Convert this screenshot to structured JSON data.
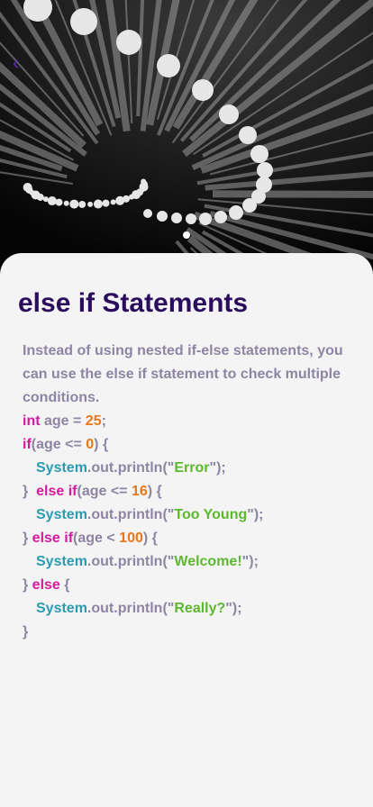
{
  "lesson": {
    "title": "else if Statements",
    "description": "Instead of using nested if-else statements, you can use the else if statement to check multiple conditions."
  },
  "nav": {
    "back_icon": "chevron-left-icon",
    "back_glyph": "‹"
  },
  "carousel": {
    "page_count": 1,
    "active_index": 0
  },
  "code": {
    "l1": {
      "kw": "int",
      "t1": " age = ",
      "num": "25",
      "t2": ";"
    },
    "l2": {
      "kw": "if",
      "t1": "(age <= ",
      "num": "0",
      "t2": ") {"
    },
    "l3": {
      "cls": "System",
      "t1": ".out.println(\"",
      "str": "Error",
      "t2": "\");"
    },
    "l4": {
      "t0": "}  ",
      "kw": "else if",
      "t1": "(age <= ",
      "num": "16",
      "t2": ") {"
    },
    "l5": {
      "cls": "System",
      "t1": ".out.println(\"",
      "str": "Too Young",
      "t2": "\");"
    },
    "l6": {
      "t0": "} ",
      "kw": "else if",
      "t1": "(age < ",
      "num": "100",
      "t2": ") {"
    },
    "l7": {
      "cls": "System",
      "t1": ".out.println(\"",
      "str": "Welcome!",
      "t2": "\");"
    },
    "l8": {
      "t0": "} ",
      "kw": "else",
      "t1": " {"
    },
    "l9": {
      "cls": "System",
      "t1": ".out.println(\"",
      "str": "Really?",
      "t2": "\");"
    },
    "l10": {
      "t0": "}"
    }
  },
  "colors": {
    "title": "#2b0d5e",
    "body_text": "#8e85a3",
    "keyword": "#d61aa0",
    "number": "#e8771a",
    "class": "#2a9bb0",
    "string": "#5cb82c",
    "card_bg": "#f4f4f4"
  }
}
